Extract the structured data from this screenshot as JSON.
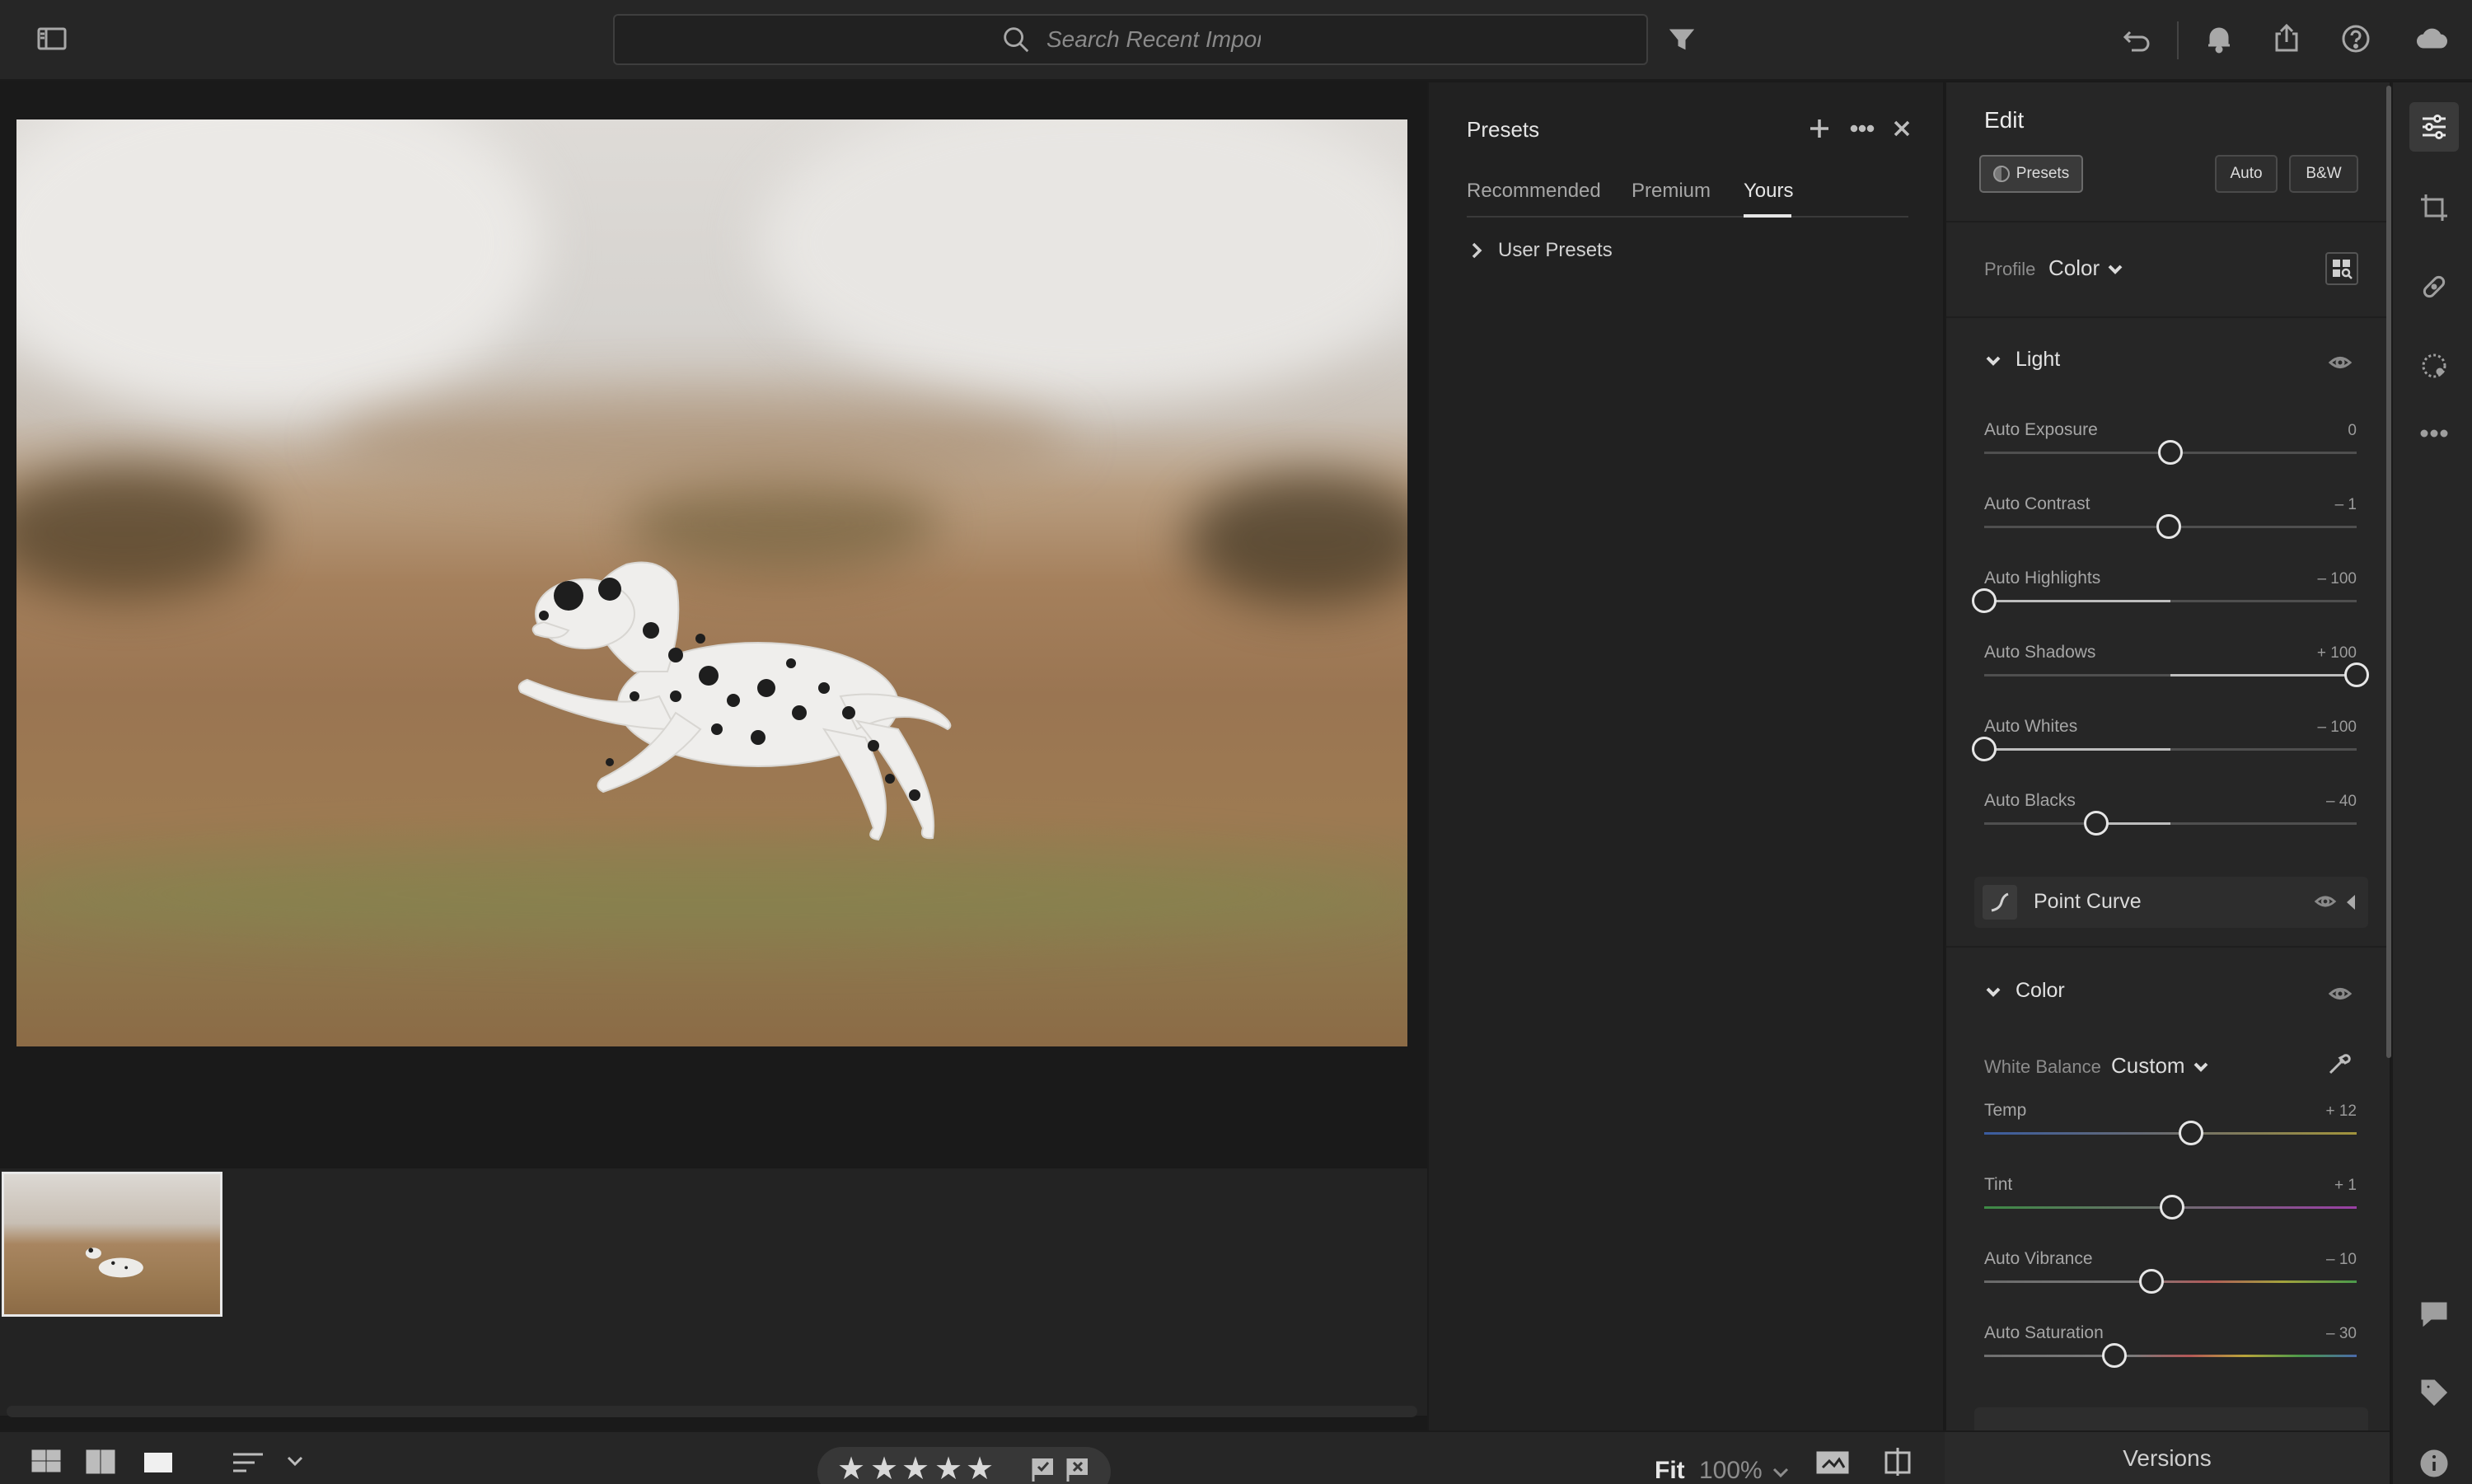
{
  "search": {
    "placeholder": "Search Recent Import"
  },
  "presets_panel": {
    "title": "Presets",
    "tabs": [
      {
        "label": "Recommended",
        "active": false
      },
      {
        "label": "Premium",
        "active": false
      },
      {
        "label": "Yours",
        "active": true
      }
    ],
    "groups": [
      {
        "label": "User Presets",
        "expanded": false
      }
    ]
  },
  "edit_panel": {
    "title": "Edit",
    "presets_button": "Presets",
    "auto_button": "Auto",
    "bw_button": "B&W",
    "profile": {
      "label": "Profile",
      "value": "Color"
    },
    "light": {
      "title": "Light",
      "sliders": [
        {
          "label": "Auto Exposure",
          "value": "0",
          "level": 0.5
        },
        {
          "label": "Auto Contrast",
          "value": "– 1",
          "level": 0.495
        },
        {
          "label": "Auto Highlights",
          "value": "– 100",
          "level": 0.0
        },
        {
          "label": "Auto Shadows",
          "value": "+ 100",
          "level": 1.0
        },
        {
          "label": "Auto Whites",
          "value": "– 100",
          "level": 0.0
        },
        {
          "label": "Auto Blacks",
          "value": "– 40",
          "level": 0.3
        }
      ]
    },
    "point_curve": {
      "label": "Point Curve"
    },
    "color": {
      "title": "Color",
      "white_balance": {
        "label": "White Balance",
        "value": "Custom"
      },
      "sliders": [
        {
          "label": "Temp",
          "value": "+ 12",
          "level": 0.555
        },
        {
          "label": "Tint",
          "value": "+ 1",
          "level": 0.505
        },
        {
          "label": "Auto Vibrance",
          "value": "– 10",
          "level": 0.45
        },
        {
          "label": "Auto Saturation",
          "value": "– 30",
          "level": 0.35
        }
      ]
    },
    "versions_label": "Versions"
  },
  "bottom_bar": {
    "fit_label": "Fit",
    "zoom_label": "100%",
    "stars": 5
  },
  "colors": {
    "bg": "#1a1a1a",
    "panel": "#262626",
    "accent_text": "#e6e6e6"
  },
  "icons": {
    "top": [
      "sidebar-toggle-icon",
      "search-icon",
      "filter-icon",
      "undo-icon",
      "bell-icon",
      "share-icon",
      "help-icon",
      "cloud-icon"
    ],
    "toolstrip": [
      "edit-sliders-icon",
      "crop-icon",
      "healing-icon",
      "masking-icon",
      "more-icon",
      "comment-icon",
      "tag-icon",
      "info-icon"
    ]
  }
}
